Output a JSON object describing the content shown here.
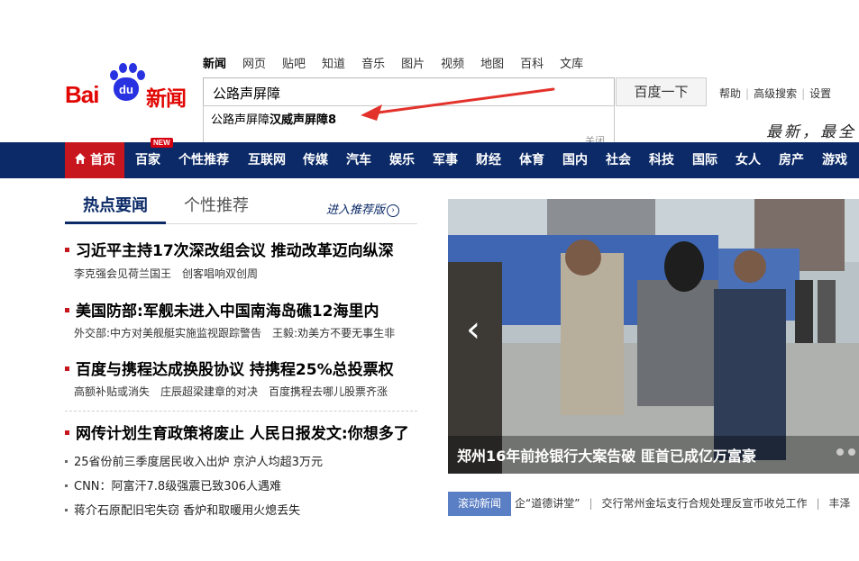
{
  "logo": {
    "bai": "Bai",
    "du": "du",
    "xinwen": "新闻"
  },
  "topnav": [
    "新闻",
    "网页",
    "贴吧",
    "知道",
    "音乐",
    "图片",
    "视频",
    "地图",
    "百科",
    "文库"
  ],
  "search": {
    "value": "公路声屏障",
    "button": "百度一下"
  },
  "suggest": {
    "prefix": "公路声屏障",
    "bold": "汉威声屏障8",
    "close": "关闭"
  },
  "toplinks": [
    "帮助",
    "高级搜索",
    "设置"
  ],
  "slogan": "最新，最全",
  "navbar": {
    "home": "首页",
    "new_tag": "NEW",
    "items": [
      "百家",
      "个性推荐",
      "互联网",
      "传媒",
      "汽车",
      "娱乐",
      "军事",
      "财经",
      "体育",
      "国内",
      "社会",
      "科技",
      "国际",
      "女人",
      "房产",
      "游戏"
    ]
  },
  "tabs": {
    "active": "热点要闻",
    "inactive": "个性推荐",
    "more": "进入推荐版"
  },
  "headlines": [
    {
      "title": "习近平主持17次深改组会议 推动改革迈向纵深",
      "subs": [
        "李克强会见荷兰国王",
        "创客唱响双创周"
      ]
    },
    {
      "title": "美国防部:军舰未进入中国南海岛礁12海里内",
      "subs": [
        "外交部:中方对美舰艇实施监视跟踪警告",
        "王毅:劝美方不要无事生非"
      ]
    },
    {
      "title": "百度与携程达成换股协议 持携程25%总投票权",
      "subs": [
        "高额补贴或消失",
        "庄辰超梁建章的对决",
        "百度携程去哪儿股票齐涨"
      ]
    },
    {
      "title": "网传计划生育政策将废止 人民日报发文:你想多了",
      "subs": []
    }
  ],
  "bullets": [
    "25省份前三季度居民收入出炉 京沪人均超3万元",
    "CNN：阿富汗7.8级强震已致306人遇难",
    "蒋介石原配旧宅失窃 香炉和取暖用火熄丢失"
  ],
  "slide": {
    "caption": "郑州16年前抢银行大案告破 匪首已成亿万富豪",
    "prev": "‹"
  },
  "ticker": {
    "label": "滚动新闻",
    "items": [
      "企“道德讲堂”",
      "交行常州金坛支行合规处理反宣币收兑工作",
      "丰泽"
    ]
  },
  "colors": {
    "brand_red": "#e10602",
    "brand_blue": "#2932e1",
    "nav_bg": "#0b2a67",
    "home_bg": "#c8161e",
    "ticker_label": "#5b7fc4"
  }
}
